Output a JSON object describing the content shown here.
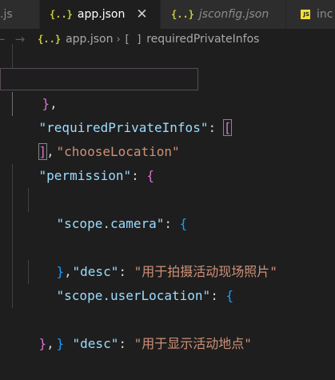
{
  "tabs": [
    {
      "label": ".js",
      "icon": "js-file-icon",
      "active": false
    },
    {
      "label": "app.json",
      "icon": "json-file-icon",
      "active": true,
      "close": "✕"
    },
    {
      "label": "jsconfig.json",
      "icon": "json-file-icon",
      "active": false
    },
    {
      "label": "inc",
      "icon": "js-file-icon",
      "active": false
    }
  ],
  "breadcrumb": {
    "nav_arrows": [
      "←",
      "→"
    ],
    "file": "app.json",
    "symbol": "requiredPrivateInfos"
  },
  "code": {
    "line1": {
      "close": "}",
      "comma": ","
    },
    "line2": {
      "key": "\"requiredPrivateInfos\"",
      "colon": ": ",
      "open": "["
    },
    "line3": {
      "value": "\"chooseLocation\""
    },
    "line4": {
      "close": "]",
      "comma": ","
    },
    "line5": {
      "key": "\"permission\"",
      "colon": ": ",
      "open": "{"
    },
    "line6": {
      "key": "\"scope.camera\"",
      "colon": ": ",
      "open": "{"
    },
    "line7": {
      "key": "\"desc\"",
      "colon": ": ",
      "value": "\"用于拍摄活动现场照片\""
    },
    "line8": {
      "close": "}",
      "comma": ","
    },
    "line9": {
      "key": "\"scope.userLocation\"",
      "colon": ": ",
      "open": "{"
    },
    "line10": {
      "key": "\"desc\"",
      "colon": ": ",
      "value": "\"用于显示活动地点\""
    },
    "line11": {
      "close": "}"
    },
    "line12": {
      "close": "}",
      "comma": ","
    }
  },
  "colors": {
    "editor_bg": "#1e1e1e",
    "key": "#9cdcfe",
    "string": "#ce9178",
    "bracket_level1": "#ffd700",
    "bracket_level2": "#da70d6",
    "bracket_level3": "#179fff",
    "json_icon": "#cbcb41",
    "js_icon": "#f1dd35"
  }
}
